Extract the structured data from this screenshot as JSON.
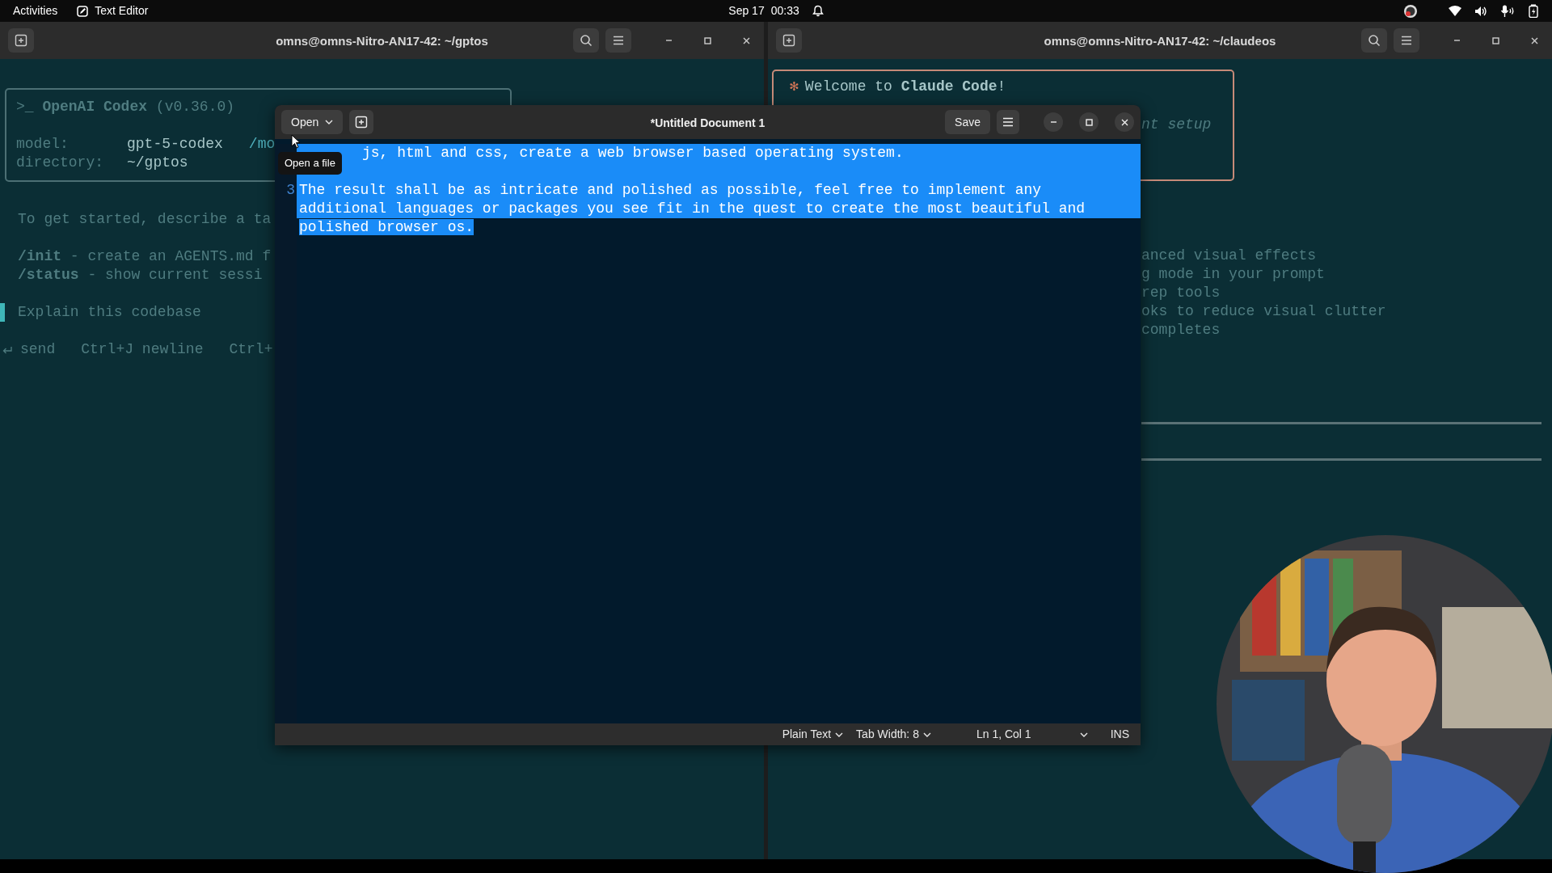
{
  "top_bar": {
    "activities": "Activities",
    "app": "Text Editor",
    "date": "Sep 17",
    "time": "00:33"
  },
  "codex_terminal": {
    "title": "omns@omns-Nitro-AN17-42: ~/gptos",
    "header": ">_ **OpenAI Codex** (v0.36.0)",
    "info": [
      {
        "label": "model:",
        "value": "gpt-5-codex",
        "extra": "/mo"
      },
      {
        "label": "directory:",
        "value": "~/gptos"
      }
    ],
    "intro": "To get started, describe a ta",
    "commands": [
      "**/init** - create an AGENTS.md f",
      "**/status** - show current sessi"
    ],
    "prompt": {
      "placeholder": "Explain this codebase"
    },
    "hints": [
      "send",
      "Ctrl+J newline",
      "Ctrl+"
    ]
  },
  "claude_terminal": {
    "title": "omns@omns-Nitro-AN17-42: ~/claudeos",
    "welcome": {
      "mark": "✻",
      "text": "Welcome to **Claude Code**!",
      "subtitle": "nt setup"
    },
    "tips": [
      "anced visual effects",
      "g mode in your prompt",
      "rep tools",
      "oks to reduce visual clutter",
      "completes"
    ]
  },
  "editor": {
    "open_button": "Open",
    "title": "*Untitled Document 1",
    "save_button": "Save",
    "tooltip": "Open a file",
    "rows": [
      {
        "text": "js, html and css, create a web browser based operating system.",
        "selected": true
      },
      {
        "selected": true
      },
      {
        "number": "3",
        "text": "The result shall be as intricate and polished as possible, feel free to implement any",
        "selected": true
      },
      {
        "text": "additional languages or packages you see fit in the quest to create the most beautiful and",
        "selected": true
      },
      {
        "text": "polished browser os.",
        "selected": true
      }
    ],
    "status": {
      "language": "Plain Text",
      "tab_width": "Tab Width: 8",
      "position": "Ln 1, Col 1",
      "mode": "INS"
    }
  }
}
